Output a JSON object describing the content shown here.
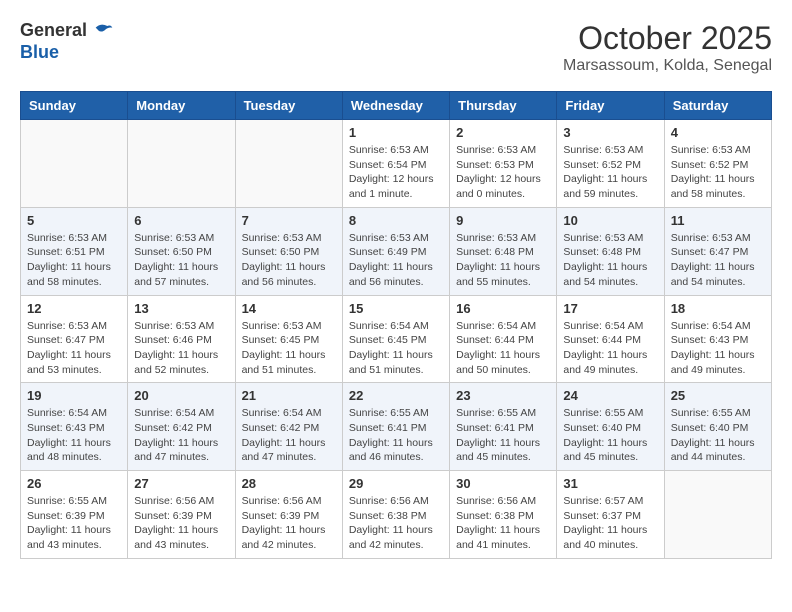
{
  "header": {
    "logo_line1": "General",
    "logo_line2": "Blue",
    "month": "October 2025",
    "location": "Marsassoum, Kolda, Senegal"
  },
  "days_of_week": [
    "Sunday",
    "Monday",
    "Tuesday",
    "Wednesday",
    "Thursday",
    "Friday",
    "Saturday"
  ],
  "weeks": [
    [
      {
        "day": "",
        "info": ""
      },
      {
        "day": "",
        "info": ""
      },
      {
        "day": "",
        "info": ""
      },
      {
        "day": "1",
        "info": "Sunrise: 6:53 AM\nSunset: 6:54 PM\nDaylight: 12 hours\nand 1 minute."
      },
      {
        "day": "2",
        "info": "Sunrise: 6:53 AM\nSunset: 6:53 PM\nDaylight: 12 hours\nand 0 minutes."
      },
      {
        "day": "3",
        "info": "Sunrise: 6:53 AM\nSunset: 6:52 PM\nDaylight: 11 hours\nand 59 minutes."
      },
      {
        "day": "4",
        "info": "Sunrise: 6:53 AM\nSunset: 6:52 PM\nDaylight: 11 hours\nand 58 minutes."
      }
    ],
    [
      {
        "day": "5",
        "info": "Sunrise: 6:53 AM\nSunset: 6:51 PM\nDaylight: 11 hours\nand 58 minutes."
      },
      {
        "day": "6",
        "info": "Sunrise: 6:53 AM\nSunset: 6:50 PM\nDaylight: 11 hours\nand 57 minutes."
      },
      {
        "day": "7",
        "info": "Sunrise: 6:53 AM\nSunset: 6:50 PM\nDaylight: 11 hours\nand 56 minutes."
      },
      {
        "day": "8",
        "info": "Sunrise: 6:53 AM\nSunset: 6:49 PM\nDaylight: 11 hours\nand 56 minutes."
      },
      {
        "day": "9",
        "info": "Sunrise: 6:53 AM\nSunset: 6:48 PM\nDaylight: 11 hours\nand 55 minutes."
      },
      {
        "day": "10",
        "info": "Sunrise: 6:53 AM\nSunset: 6:48 PM\nDaylight: 11 hours\nand 54 minutes."
      },
      {
        "day": "11",
        "info": "Sunrise: 6:53 AM\nSunset: 6:47 PM\nDaylight: 11 hours\nand 54 minutes."
      }
    ],
    [
      {
        "day": "12",
        "info": "Sunrise: 6:53 AM\nSunset: 6:47 PM\nDaylight: 11 hours\nand 53 minutes."
      },
      {
        "day": "13",
        "info": "Sunrise: 6:53 AM\nSunset: 6:46 PM\nDaylight: 11 hours\nand 52 minutes."
      },
      {
        "day": "14",
        "info": "Sunrise: 6:53 AM\nSunset: 6:45 PM\nDaylight: 11 hours\nand 51 minutes."
      },
      {
        "day": "15",
        "info": "Sunrise: 6:54 AM\nSunset: 6:45 PM\nDaylight: 11 hours\nand 51 minutes."
      },
      {
        "day": "16",
        "info": "Sunrise: 6:54 AM\nSunset: 6:44 PM\nDaylight: 11 hours\nand 50 minutes."
      },
      {
        "day": "17",
        "info": "Sunrise: 6:54 AM\nSunset: 6:44 PM\nDaylight: 11 hours\nand 49 minutes."
      },
      {
        "day": "18",
        "info": "Sunrise: 6:54 AM\nSunset: 6:43 PM\nDaylight: 11 hours\nand 49 minutes."
      }
    ],
    [
      {
        "day": "19",
        "info": "Sunrise: 6:54 AM\nSunset: 6:43 PM\nDaylight: 11 hours\nand 48 minutes."
      },
      {
        "day": "20",
        "info": "Sunrise: 6:54 AM\nSunset: 6:42 PM\nDaylight: 11 hours\nand 47 minutes."
      },
      {
        "day": "21",
        "info": "Sunrise: 6:54 AM\nSunset: 6:42 PM\nDaylight: 11 hours\nand 47 minutes."
      },
      {
        "day": "22",
        "info": "Sunrise: 6:55 AM\nSunset: 6:41 PM\nDaylight: 11 hours\nand 46 minutes."
      },
      {
        "day": "23",
        "info": "Sunrise: 6:55 AM\nSunset: 6:41 PM\nDaylight: 11 hours\nand 45 minutes."
      },
      {
        "day": "24",
        "info": "Sunrise: 6:55 AM\nSunset: 6:40 PM\nDaylight: 11 hours\nand 45 minutes."
      },
      {
        "day": "25",
        "info": "Sunrise: 6:55 AM\nSunset: 6:40 PM\nDaylight: 11 hours\nand 44 minutes."
      }
    ],
    [
      {
        "day": "26",
        "info": "Sunrise: 6:55 AM\nSunset: 6:39 PM\nDaylight: 11 hours\nand 43 minutes."
      },
      {
        "day": "27",
        "info": "Sunrise: 6:56 AM\nSunset: 6:39 PM\nDaylight: 11 hours\nand 43 minutes."
      },
      {
        "day": "28",
        "info": "Sunrise: 6:56 AM\nSunset: 6:39 PM\nDaylight: 11 hours\nand 42 minutes."
      },
      {
        "day": "29",
        "info": "Sunrise: 6:56 AM\nSunset: 6:38 PM\nDaylight: 11 hours\nand 42 minutes."
      },
      {
        "day": "30",
        "info": "Sunrise: 6:56 AM\nSunset: 6:38 PM\nDaylight: 11 hours\nand 41 minutes."
      },
      {
        "day": "31",
        "info": "Sunrise: 6:57 AM\nSunset: 6:37 PM\nDaylight: 11 hours\nand 40 minutes."
      },
      {
        "day": "",
        "info": ""
      }
    ]
  ]
}
